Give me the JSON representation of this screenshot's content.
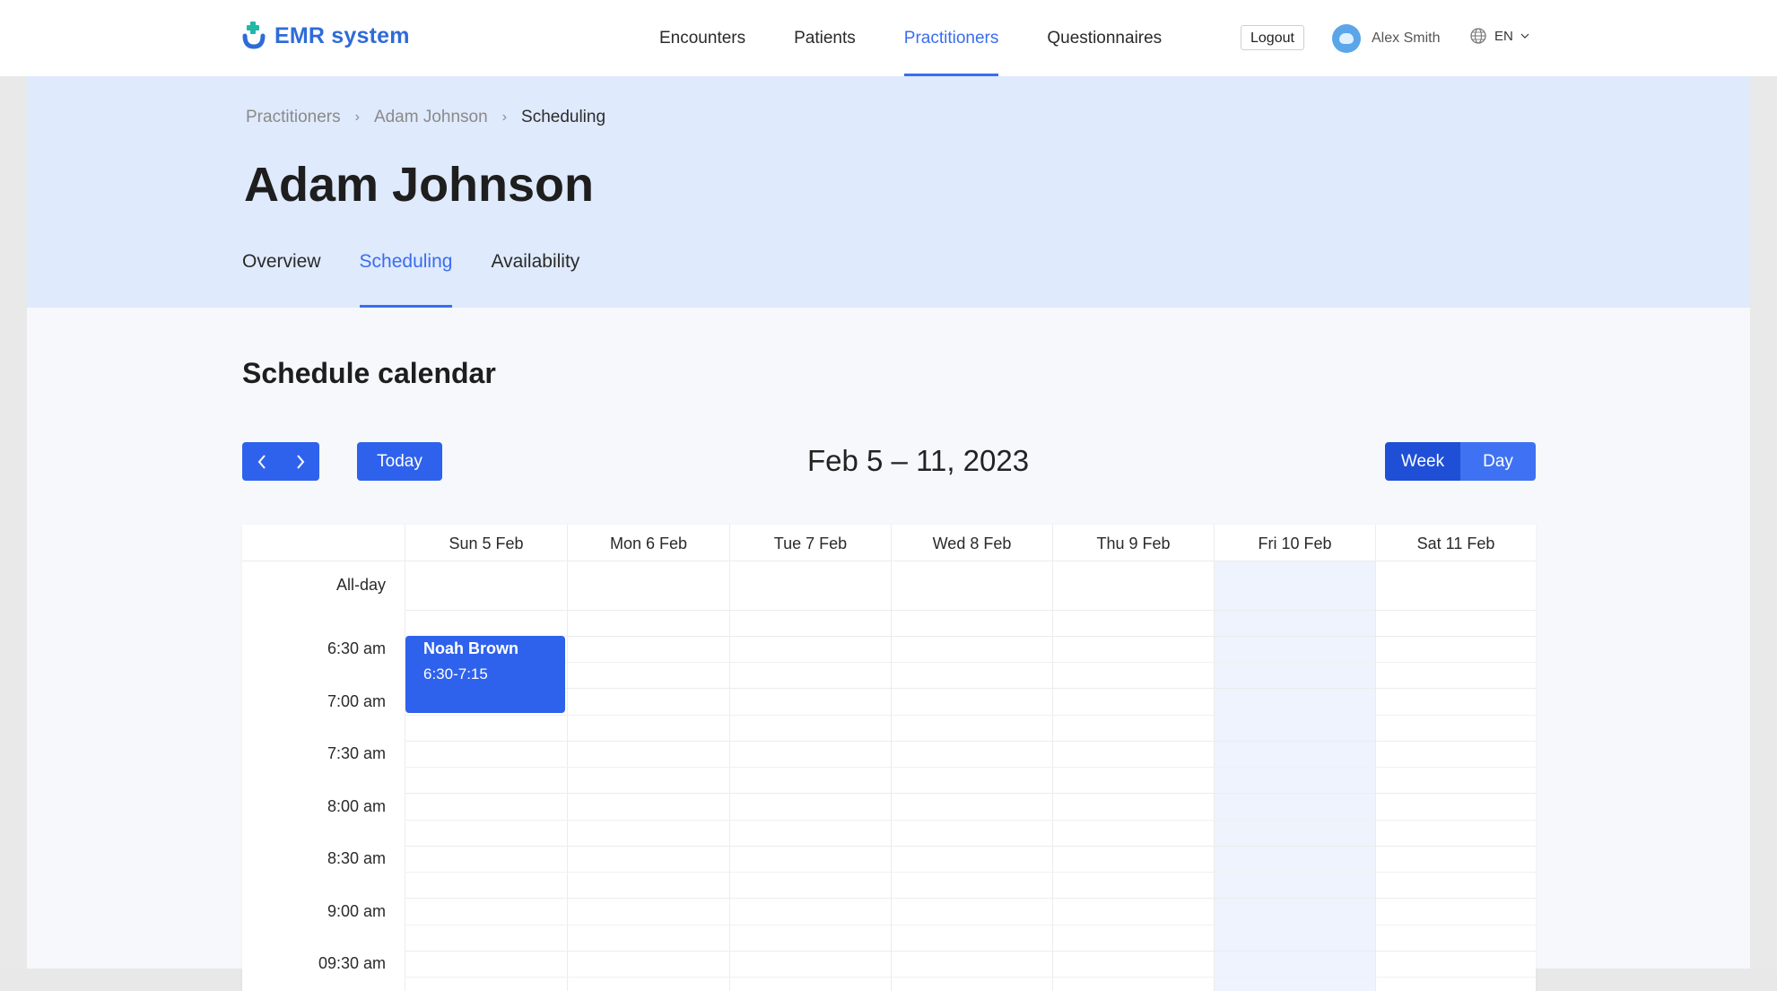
{
  "header": {
    "logo_text": "EMR system",
    "nav": [
      "Encounters",
      "Patients",
      "Practitioners",
      "Questionnaires"
    ],
    "active_nav": "Practitioners",
    "logout_label": "Logout",
    "user_name": "Alex Smith",
    "language": "EN"
  },
  "breadcrumb": [
    "Practitioners",
    "Adam Johnson",
    "Scheduling"
  ],
  "page_title": "Adam Johnson",
  "tabs": [
    "Overview",
    "Scheduling",
    "Availability"
  ],
  "active_tab": "Scheduling",
  "schedule": {
    "title": "Schedule calendar",
    "today_label": "Today",
    "range_label": "Feb 5 – 11, 2023",
    "view_week": "Week",
    "view_day": "Day",
    "days": [
      "Sun 5 Feb",
      "Mon 6 Feb",
      "Tue 7 Feb",
      "Wed 8 Feb",
      "Thu 9 Feb",
      "Fri 10 Feb",
      "Sat 11 Feb"
    ],
    "highlighted_day": "Fri 10 Feb",
    "all_day_label": "All-day",
    "times": [
      "6:30 am",
      "7:00 am",
      "7:30 am",
      "8:00 am",
      "8:30 am",
      "9:00 am",
      "09:30 am"
    ],
    "events": [
      {
        "name": "Noah Brown",
        "time": "6:30-7:15",
        "day": "Sun 5 Feb"
      }
    ]
  },
  "colors": {
    "accent": "#3a6df0",
    "hero_bg": "#dfeafc",
    "button": "#2f62ec",
    "week_active": "#1f4fd6"
  }
}
